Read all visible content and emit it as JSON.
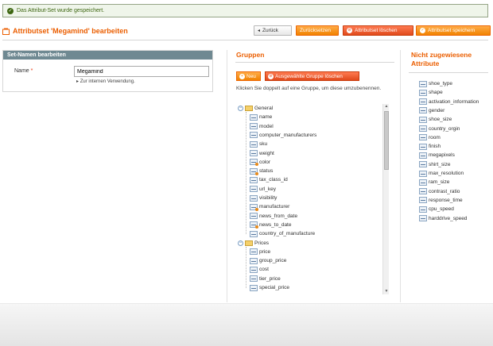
{
  "message": {
    "text": "Das Attribut-Set wurde gespeichert."
  },
  "header": {
    "title": "Attributset 'Megamind' bearbeiten",
    "buttons": {
      "back": "Zurück",
      "reset": "Zurücksetzen",
      "delete": "Attributset löschen",
      "save": "Attributset speichern"
    }
  },
  "set_name": {
    "heading": "Set-Namen bearbeiten",
    "label": "Name",
    "required_mark": "*",
    "value": "Megamind",
    "note": "Zur internen Verwendung."
  },
  "groups": {
    "title": "Gruppen",
    "new_label": "Neu",
    "delete_label": "Ausgewählte Gruppe löschen",
    "hint": "Klicken Sie doppelt auf eine Gruppe, um diese umzubenennen.",
    "tree": [
      {
        "name": "General",
        "items": [
          "name",
          "model",
          "computer_manufacturers",
          "sku",
          "weight",
          "color",
          "status",
          "tax_class_id",
          "url_key",
          "visibility",
          "manufacturer",
          "news_from_date",
          "news_to_date",
          "country_of_manufacture"
        ]
      },
      {
        "name": "Prices",
        "items": [
          "price",
          "group_price",
          "cost",
          "tier_price",
          "special_price"
        ]
      }
    ]
  },
  "unassigned": {
    "title_line1": "Nicht zugewiesene",
    "title_line2": "Attribute",
    "items": [
      "shoe_type",
      "shape",
      "activation_information",
      "gender",
      "shoe_size",
      "country_orgin",
      "room",
      "finish",
      "megapixels",
      "shirt_size",
      "max_resolution",
      "ram_size",
      "contrast_ratio",
      "response_time",
      "cpu_speed",
      "harddrive_speed"
    ]
  }
}
